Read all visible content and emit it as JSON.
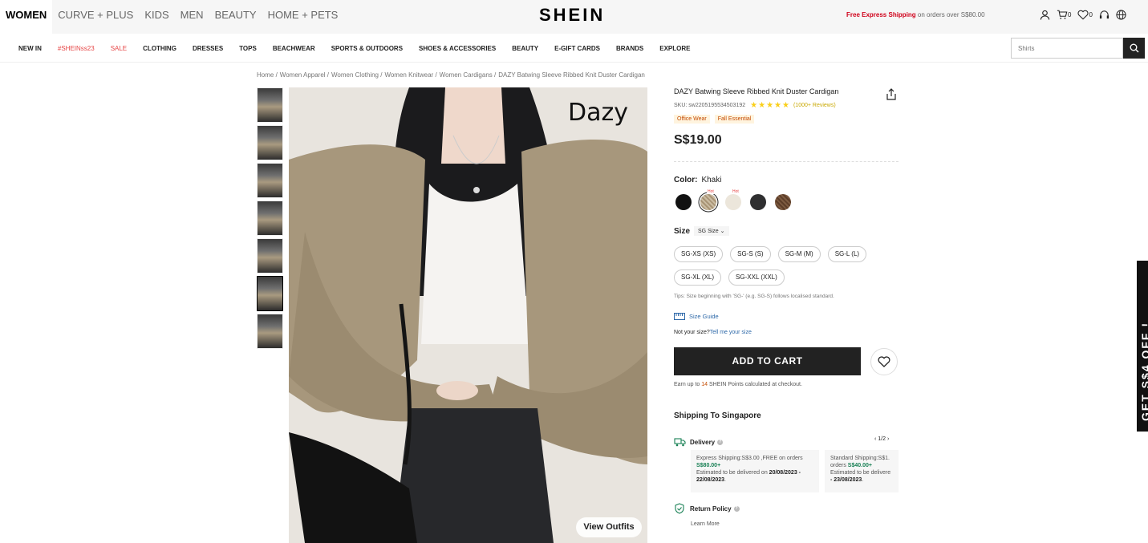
{
  "header": {
    "categories": [
      "WOMEN",
      "CURVE + PLUS",
      "KIDS",
      "MEN",
      "BEAUTY",
      "HOME + PETS"
    ],
    "logo": "SHEIN",
    "promo_bold": "Free Express Shipping",
    "promo_rest": " on orders over S$80.00",
    "cart_count": "0",
    "wish_count": "0"
  },
  "nav": {
    "items": [
      "NEW IN",
      "#SHEINss23",
      "SALE",
      "CLOTHING",
      "DRESSES",
      "TOPS",
      "BEACHWEAR",
      "SPORTS & OUTDOORS",
      "SHOES & ACCESSORIES",
      "BEAUTY",
      "E-GIFT CARDS",
      "BRANDS",
      "EXPLORE"
    ],
    "search_placeholder": "Shirts"
  },
  "breadcrumb": [
    "Home /",
    "Women Apparel /",
    "Women Clothing /",
    "Women Knitwear /",
    "Women Cardigans /",
    "DAZY Batwing Sleeve Ribbed Knit Duster Cardigan"
  ],
  "gallery": {
    "brand_watermark": "Dazy",
    "view_outfits": "View Outfits"
  },
  "product": {
    "title": "DAZY Batwing Sleeve Ribbed Knit Duster Cardigan",
    "sku": "SKU: sw2205195534503192",
    "rating_stars": "★★★★★",
    "reviews": "(1000+ Reviews)",
    "tags": [
      "Office Wear",
      "Fall Essential"
    ],
    "price": "S$19.00",
    "color_label": "Color:",
    "color_value": "Khaki",
    "hot_label": "Hot",
    "size_label": "Size",
    "size_selector": "SG Size",
    "sizes": [
      "SG-XS (XS)",
      "SG-S (S)",
      "SG-M (M)",
      "SG-L (L)",
      "SG-XL (XL)",
      "SG-XXL (XXL)"
    ],
    "tips": "Tips: Size beginning with 'SG-' (e.g. SG-S) follows localised standard.",
    "size_guide": "Size Guide",
    "not_your_size": "Not your size?",
    "tell_me": "Tell me your size",
    "add_to_cart": "ADD TO CART",
    "points_pre": "Earn up to ",
    "points_num": "14",
    "points_post": " SHEIN Points calculated at checkout."
  },
  "shipping": {
    "title": "Shipping To Singapore",
    "delivery_label": "Delivery",
    "pager": "1/2",
    "express_line1": "Express Shipping:S$3.00 ,FREE on orders ",
    "express_threshold": "S$80.00+",
    "express_est": "Estimated to be delivered on ",
    "express_dates": "20/08/2023 - 22/08/2023",
    "standard_line1": "Standard Shipping:S$1.",
    "standard_line1b": "orders ",
    "standard_threshold": "S$40.00+",
    "standard_est": "Estimated to be delivere",
    "standard_dates": "- 23/08/2023",
    "return_label": "Return Policy",
    "learn_more": "Learn More"
  },
  "side_promo": "GET S$4 OFF !"
}
